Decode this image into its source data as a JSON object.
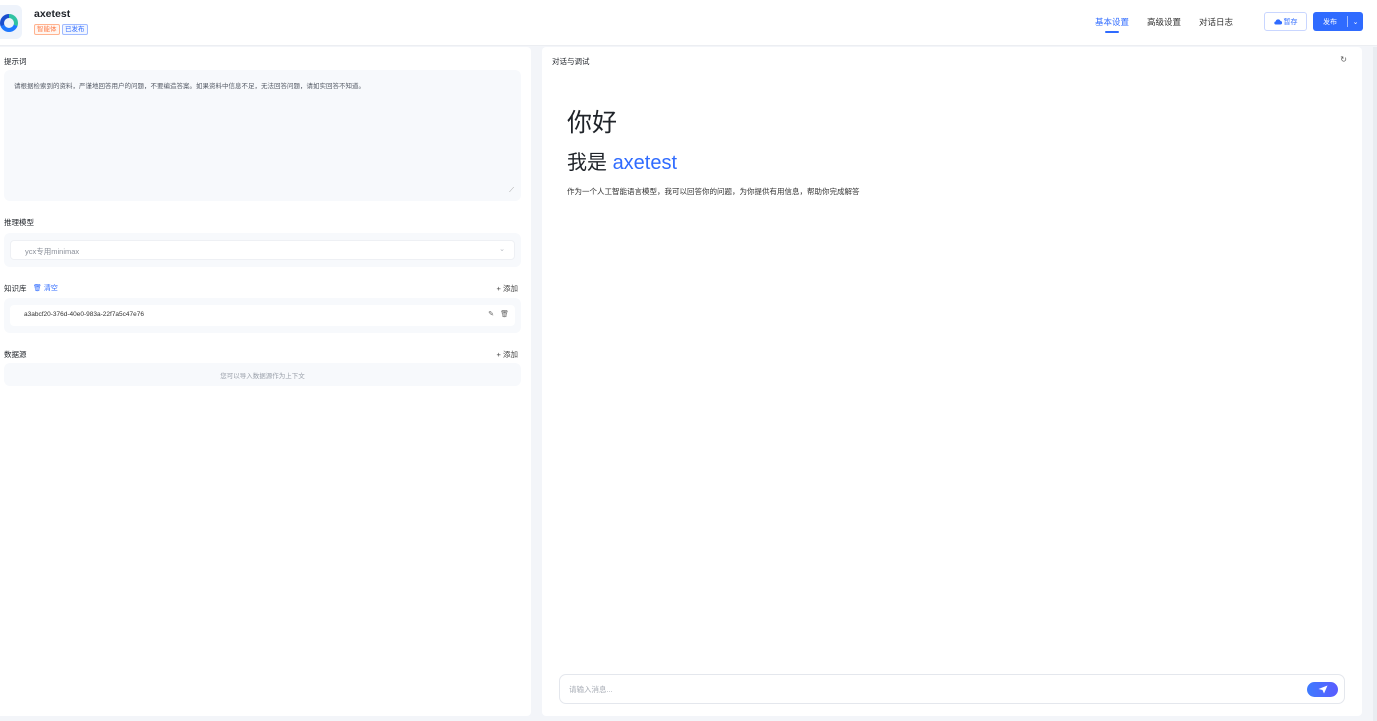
{
  "app": {
    "name": "axetest",
    "tags": [
      "智能体",
      "已发布"
    ]
  },
  "nav": {
    "tabs": [
      "基本设置",
      "高级设置",
      "对话日志"
    ],
    "active_tab": "基本设置"
  },
  "toolbar": {
    "save_label": "暂存",
    "publish_label": "发布"
  },
  "left": {
    "prompt": {
      "label": "提示词",
      "text": "请根据检索到的资料，严谨地回答用户的问题，不要编造答案。如果资料中信息不足，无法回答问题，请如实回答不知道。"
    },
    "model": {
      "label": "推理模型",
      "value": "ycx专用minimax"
    },
    "knowledge": {
      "label": "知识库",
      "clear_label": "清空",
      "add_label": "添加",
      "items": [
        "a3abcf20-376d-40e0-983a-22f7a5c47e76"
      ]
    },
    "datasource": {
      "label": "数据源",
      "add_label": "添加",
      "empty_text": "您可以导入数据源作为上下文"
    }
  },
  "chat": {
    "title": "对话与调试",
    "greeting": "你好",
    "intro_prefix": "我是 ",
    "intro_name": "axetest",
    "description": "作为一个人工智能语言模型，我可以回答你的问题，为你提供有用信息，帮助你完成解答",
    "input_placeholder": "请输入消息..."
  },
  "colors": {
    "accent": "#2f6bff",
    "tag_agent": "#ff7a45"
  }
}
